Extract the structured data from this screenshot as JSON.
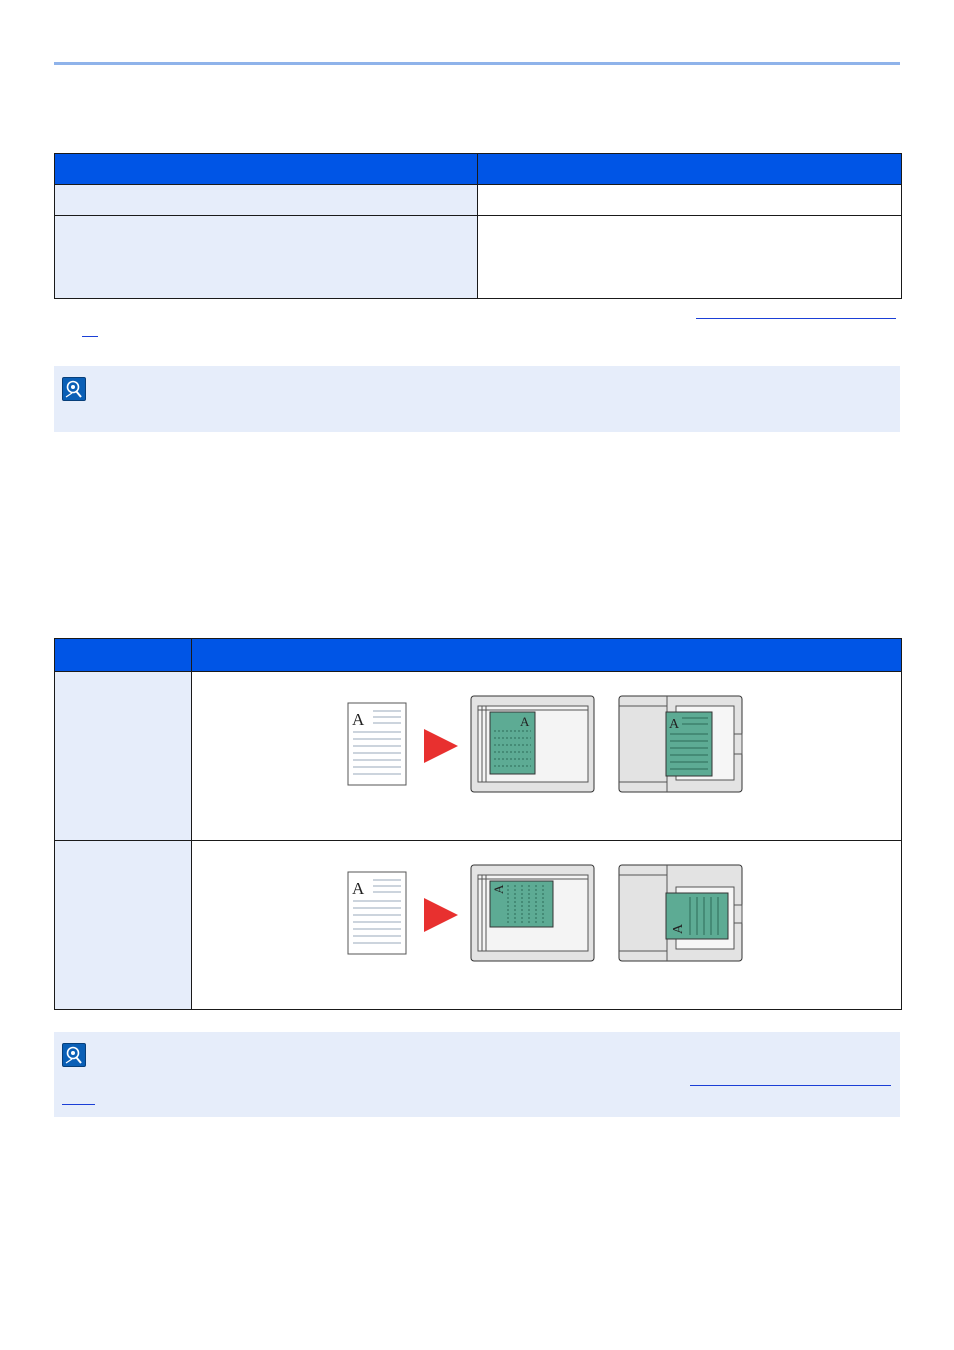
{
  "table1": {
    "headers": [
      "",
      ""
    ],
    "rows": [
      {
        "label": "",
        "value": ""
      },
      {
        "label": "",
        "value": ""
      }
    ]
  },
  "table1_reference_link": "",
  "note1": {
    "icon": "note-icon",
    "text": ""
  },
  "table2": {
    "headers": [
      "",
      ""
    ],
    "rows": [
      {
        "label": "",
        "figure": {
          "original_letter": "A",
          "glass_letter": "A",
          "feeder_letter": "A"
        }
      },
      {
        "label": "",
        "figure": {
          "original_letter": "A",
          "glass_letter": "A",
          "feeder_letter": "A"
        }
      }
    ]
  },
  "note2": {
    "icon": "note-icon",
    "text": "",
    "link_text": ""
  },
  "colors": {
    "header_blue": "#0055e6",
    "cell_tint": "#e6edfa",
    "arrow_red": "#e8302f",
    "sheet_green": "#5dab94",
    "link_blue": "#1b3fd6"
  }
}
